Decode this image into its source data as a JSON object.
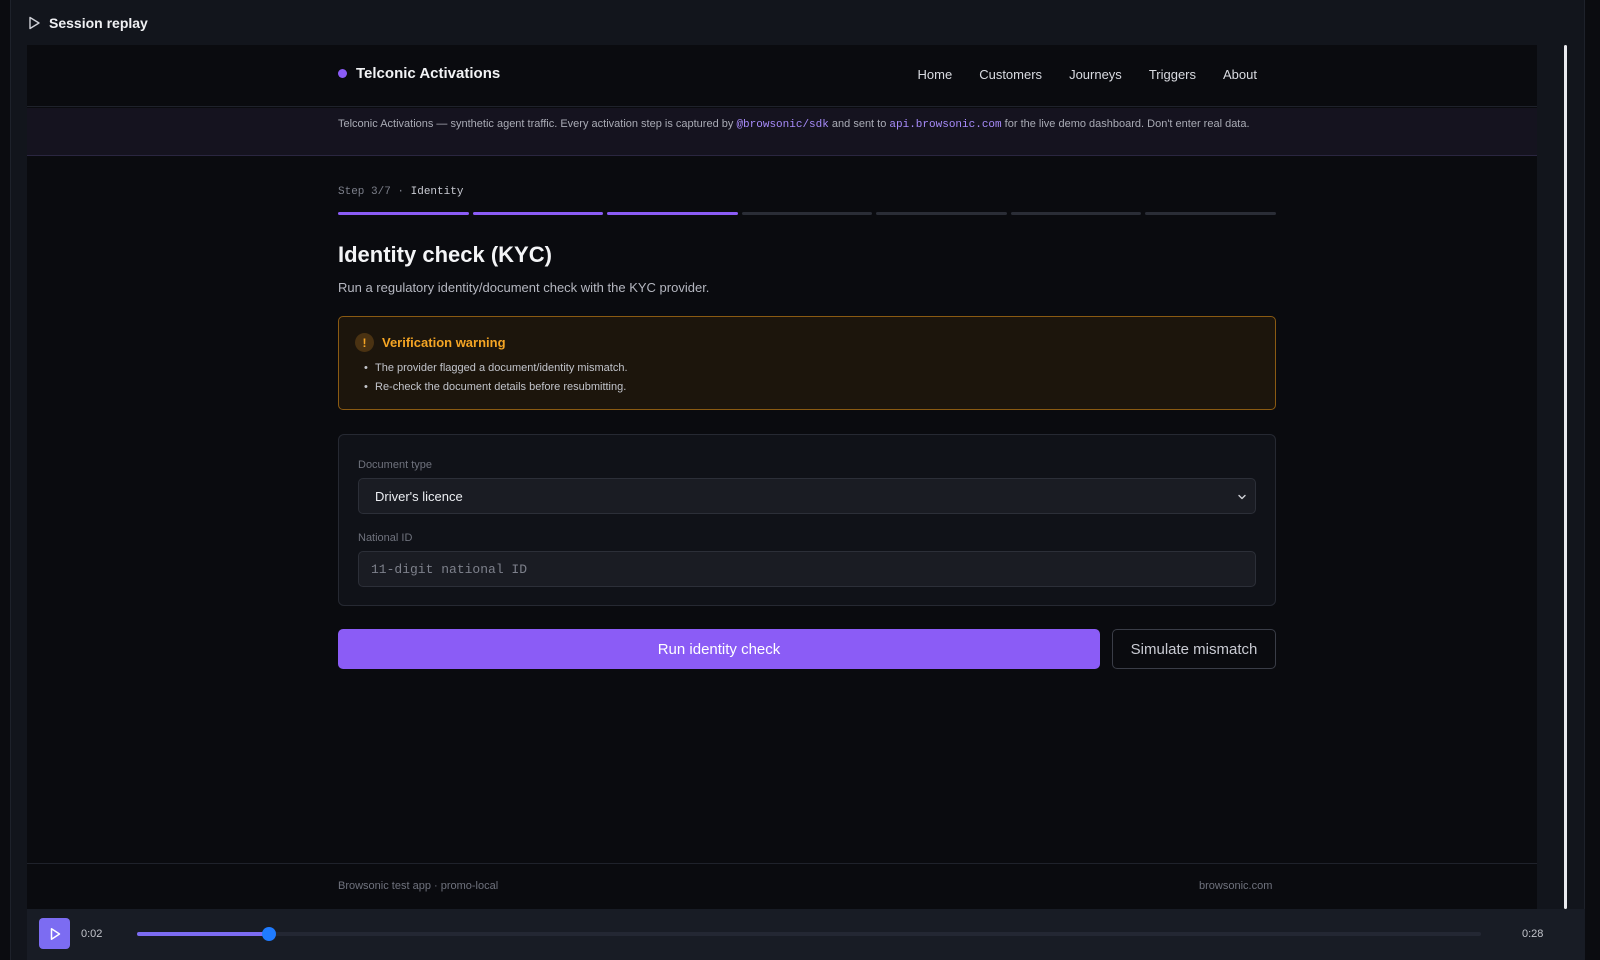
{
  "replay": {
    "title": "Session replay",
    "current_time": "0:02",
    "end_time": "0:28",
    "progress": 0.098
  },
  "nav": {
    "brand": "Telconic Activations",
    "links": [
      "Home",
      "Customers",
      "Journeys",
      "Triggers",
      "About"
    ]
  },
  "banner": {
    "text_before": "Telconic Activations — synthetic agent traffic. Every activation step is captured by ",
    "sdk": "@browsonic/sdk",
    "text_mid": " and sent to ",
    "api": "api.browsonic.com",
    "text_after": " for the live demo dashboard. Don't enter real data."
  },
  "step": {
    "label": "Step 3/7",
    "separator": " · ",
    "name": "Identity",
    "current": 3,
    "total": 7
  },
  "page": {
    "title": "Identity check (KYC)",
    "subtitle": "Run a regulatory identity/document check with the KYC provider."
  },
  "warning": {
    "icon": "!",
    "title": "Verification warning",
    "items": [
      "The provider flagged a document/identity mismatch.",
      "Re-check the document details before resubmitting."
    ]
  },
  "form": {
    "doc_type_label": "Document type",
    "doc_type_value": "Driver's licence",
    "national_id_label": "National ID",
    "national_id_placeholder": "11-digit national ID",
    "national_id_value": ""
  },
  "actions": {
    "primary": "Run identity check",
    "secondary": "Simulate mismatch"
  },
  "footer": {
    "left": "Browsonic test app · promo-local",
    "right": "browsonic.com"
  },
  "colors": {
    "accent": "#8b5cf6",
    "warning": "#f5a524",
    "scrubber_thumb": "#1f7bff"
  }
}
